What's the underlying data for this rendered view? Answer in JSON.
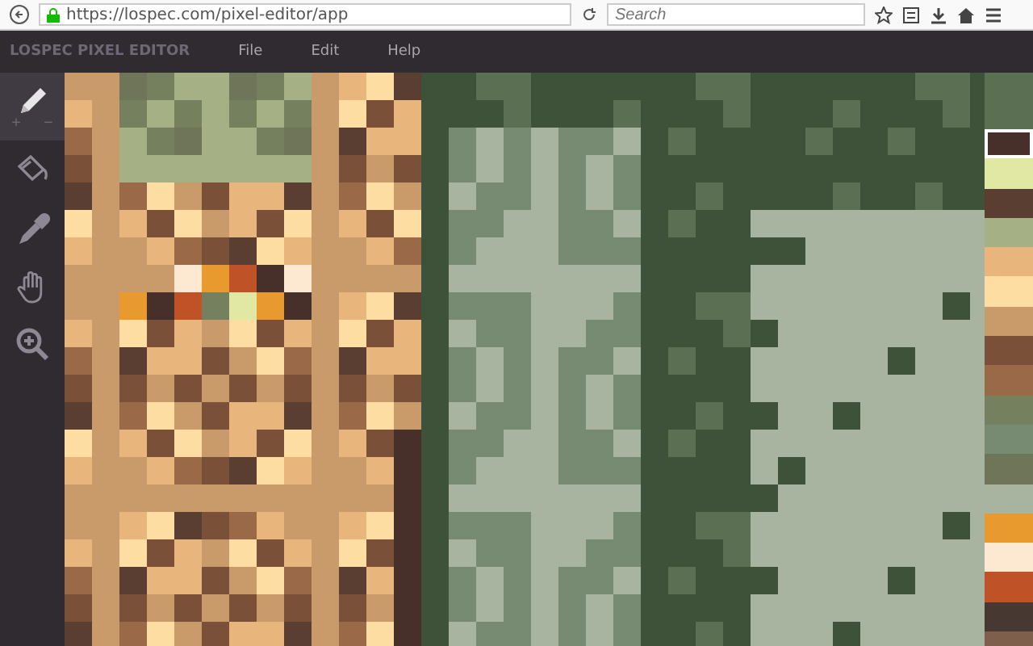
{
  "browser": {
    "url": "https://lospec.com/pixel-editor/app",
    "placeholder": "Search"
  },
  "app": {
    "title": "LOSPEC PIXEL EDITOR",
    "menu": [
      "File",
      "Edit",
      "Help"
    ]
  },
  "tools": [
    {
      "kind": "pencil",
      "selected": true,
      "size_controls": [
        "+",
        "−"
      ]
    },
    {
      "kind": "bucket",
      "selected": false
    },
    {
      "kind": "eyedropper",
      "selected": false
    },
    {
      "kind": "hand",
      "selected": false
    },
    {
      "kind": "zoom",
      "selected": false
    }
  ],
  "palette": [
    {
      "color": "#47302a",
      "selected": true
    },
    {
      "color": "#e1e8a4",
      "selected": false
    },
    {
      "color": "#5a3e32",
      "selected": false
    },
    {
      "color": "#a5b084",
      "selected": false
    },
    {
      "color": "#e8b57c",
      "selected": false
    },
    {
      "color": "#fddda2",
      "selected": false
    },
    {
      "color": "#c99a6a",
      "selected": false
    },
    {
      "color": "#7a5038",
      "selected": false
    },
    {
      "color": "#9a6a48",
      "selected": false
    },
    {
      "color": "#75815e",
      "selected": false
    },
    {
      "color": "#768b72",
      "selected": false
    },
    {
      "color": "#6f7558",
      "selected": false
    },
    {
      "color": "#a8b49f",
      "selected": false
    },
    {
      "color": "#e89a2e",
      "selected": false
    },
    {
      "color": "#fde9d2",
      "selected": false
    },
    {
      "color": "#c05228",
      "selected": false
    },
    {
      "color": "#483832",
      "selected": false
    },
    {
      "color": "#7d5f4c",
      "selected": false
    }
  ]
}
